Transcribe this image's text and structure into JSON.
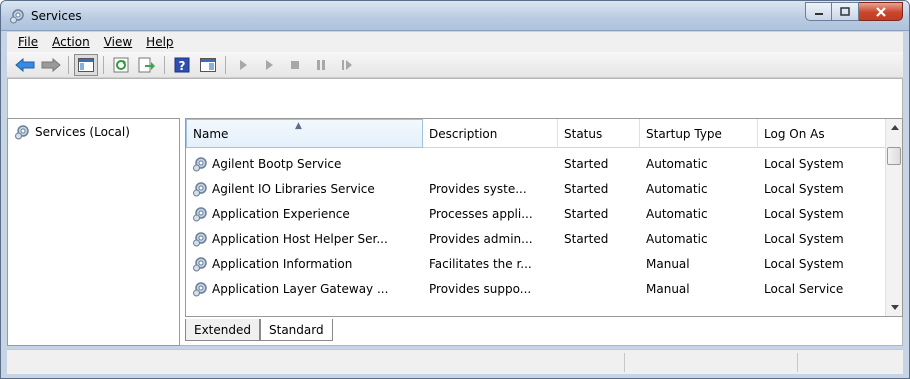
{
  "window": {
    "title": "Services",
    "title_icon": "gears-icon"
  },
  "menu": [
    {
      "label": "File"
    },
    {
      "label": "Action"
    },
    {
      "label": "View"
    },
    {
      "label": "Help"
    }
  ],
  "toolbar": {
    "buttons": [
      "back-icon",
      "forward-icon",
      "show-hide-console-tree-icon",
      "refresh-icon",
      "export-list-icon",
      "help-icon",
      "properties-icon",
      "start-service-icon",
      "start-service-alt-icon",
      "stop-service-icon",
      "pause-service-icon",
      "resume-service-icon"
    ]
  },
  "tree": {
    "root_label": "Services (Local)"
  },
  "list": {
    "columns": [
      "Name",
      "Description",
      "Status",
      "Startup Type",
      "Log On As"
    ],
    "rows": [
      {
        "name": "Agilent Bootp Service",
        "description": "",
        "status": "Started",
        "startup": "Automatic",
        "logon": "Local System"
      },
      {
        "name": "Agilent IO Libraries Service",
        "description": "Provides syste...",
        "status": "Started",
        "startup": "Automatic",
        "logon": "Local System"
      },
      {
        "name": "Application Experience",
        "description": "Processes appli...",
        "status": "Started",
        "startup": "Automatic",
        "logon": "Local System"
      },
      {
        "name": "Application Host Helper Ser...",
        "description": "Provides admin...",
        "status": "Started",
        "startup": "Automatic",
        "logon": "Local System"
      },
      {
        "name": "Application Information",
        "description": "Facilitates the r...",
        "status": "",
        "startup": "Manual",
        "logon": "Local System"
      },
      {
        "name": "Application Layer Gateway ...",
        "description": "Provides suppo...",
        "status": "",
        "startup": "Manual",
        "logon": "Local Service"
      }
    ]
  },
  "tabs": [
    {
      "label": "Extended"
    },
    {
      "label": "Standard"
    }
  ]
}
